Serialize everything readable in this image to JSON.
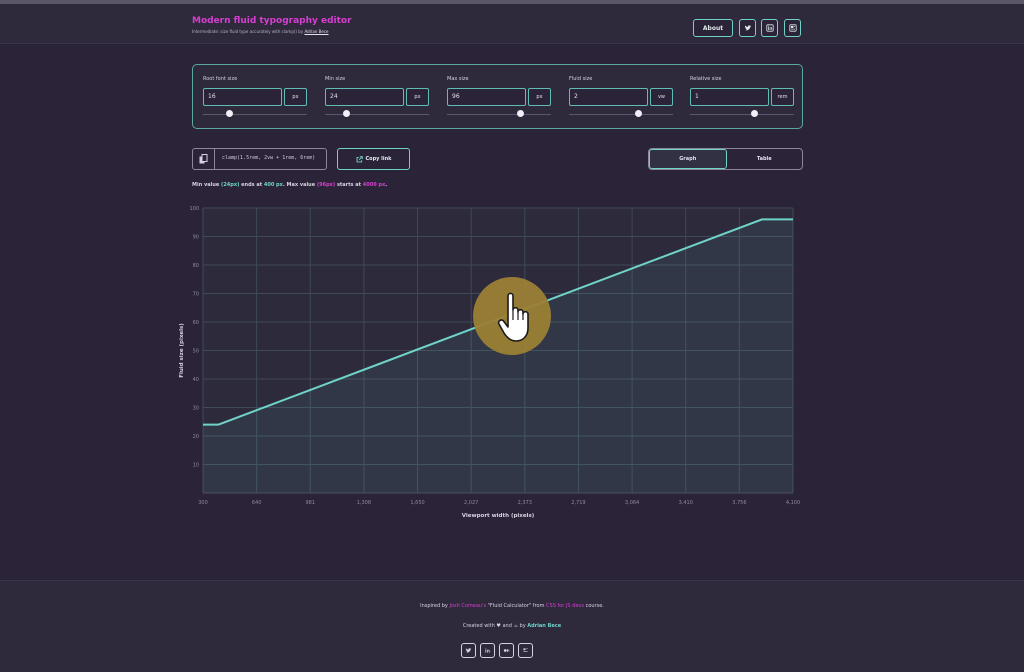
{
  "header": {
    "title": "Modern fluid typography editor",
    "subtitle_text": "Intermediate: size fluid type accurately with clamp() by",
    "subtitle_link": "Adrian Bece",
    "about_label": "About",
    "social_icons": [
      "twitter-icon",
      "linkedin-icon",
      "medium-icon",
      "blog-icon"
    ]
  },
  "controls": [
    {
      "label": "Root font size",
      "value": "16",
      "unit": "px",
      "slider": 0.25
    },
    {
      "label": "Min size",
      "value": "24",
      "unit": "px",
      "slider": 0.2
    },
    {
      "label": "Max size",
      "value": "96",
      "unit": "px",
      "slider": 0.7
    },
    {
      "label": "Fluid size",
      "value": "2",
      "unit": "vw",
      "slider": 0.65
    },
    {
      "label": "Relative size",
      "value": "1",
      "unit": "rem",
      "slider": 0.6
    }
  ],
  "clamp": {
    "code": "clamp(1.5rem, 2vw + 1rem, 6rem)",
    "copy_icon": "copy-icon"
  },
  "copy_link_label": "Copy link",
  "copy_link_icon": "external-link-icon",
  "view_tabs": [
    {
      "label": "Graph",
      "active": true
    },
    {
      "label": "Table",
      "active": false
    }
  ],
  "range_note": {
    "prefix": "Min value ",
    "min_value": "(24px)",
    "mid1": " ends at ",
    "min_vw": "400 px",
    "mid2": ". Max value ",
    "max_value": "(96px)",
    "mid3": " starts at ",
    "max_vw": "4000 px",
    "suffix": "."
  },
  "chart_data": {
    "type": "line",
    "xlabel": "Viewport width (pixels)",
    "ylabel": "Fluid size (pixels)",
    "x_ticks": [
      "300",
      "640",
      "981",
      "1,308",
      "1,650",
      "2,027",
      "2,373",
      "2,719",
      "3,064",
      "3,410",
      "3,756",
      "4,100"
    ],
    "y_ticks": [
      "100",
      "90",
      "80",
      "70",
      "60",
      "50",
      "40",
      "30",
      "20",
      "10"
    ],
    "xlim": [
      300,
      4100
    ],
    "ylim": [
      0,
      100
    ],
    "grid": true,
    "series": [
      {
        "x": [
          300,
          400,
          3900,
          4100
        ],
        "y": [
          24,
          24,
          96,
          96
        ],
        "color": "#6fd3c9"
      }
    ]
  },
  "footer": {
    "inspired_pre": "Inspired by ",
    "inspired_person": "Josh Comeau's",
    "inspired_mid": " \"Fluid Calculator\" from ",
    "inspired_course": "CSS for JS devs",
    "inspired_post": " course.",
    "created_pre": "Created with ",
    "created_mid": " and ",
    "created_by": " by ",
    "author": "Adrian Bece",
    "social_icons": [
      "twitter-icon",
      "linkedin-icon",
      "medium-icon",
      "blog-icon"
    ]
  },
  "cursor": {
    "icon": "hand-pointer-icon",
    "highlight_color": "#9b7f35"
  }
}
